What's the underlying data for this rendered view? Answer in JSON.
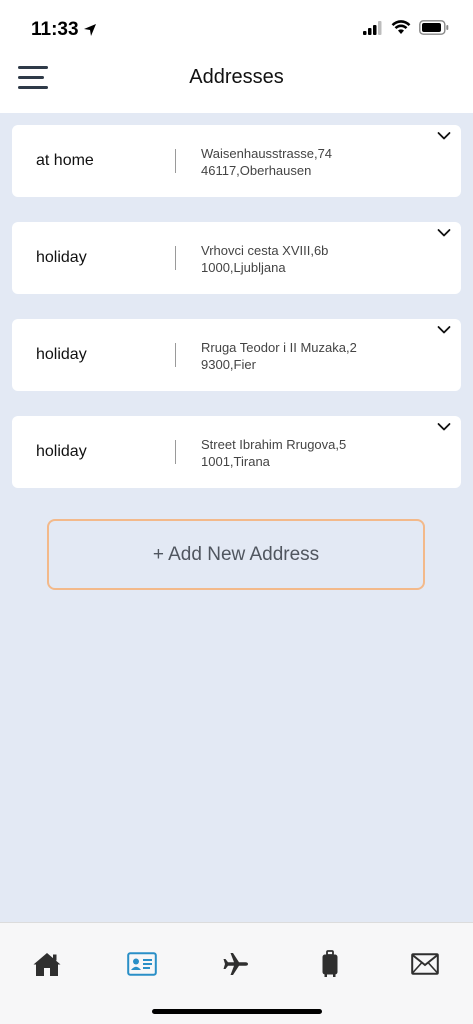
{
  "status": {
    "time": "11:33"
  },
  "header": {
    "title": "Addresses"
  },
  "addresses": [
    {
      "label": "at home",
      "line1": "Waisenhausstrasse,74",
      "line2": "46117,Oberhausen"
    },
    {
      "label": "holiday",
      "line1": "Vrhovci cesta XVIII,6b",
      "line2": "1000,Ljubljana"
    },
    {
      "label": "holiday",
      "line1": "Rruga Teodor i II Muzaka,2",
      "line2": "9300,Fier"
    },
    {
      "label": "holiday",
      "line1": "Street Ibrahim Rrugova,5",
      "line2": "1001,Tirana"
    }
  ],
  "actions": {
    "add_label": "+ Add New Address"
  },
  "tabbar": {
    "items": [
      "home-icon",
      "contact-card-icon",
      "airplane-icon",
      "luggage-icon",
      "mail-icon"
    ],
    "active_index": 1
  },
  "colors": {
    "background": "#e3e9f4",
    "add_border": "#f3b98a",
    "active_tab": "#2a8fc7",
    "icon": "#2f2f2f"
  }
}
